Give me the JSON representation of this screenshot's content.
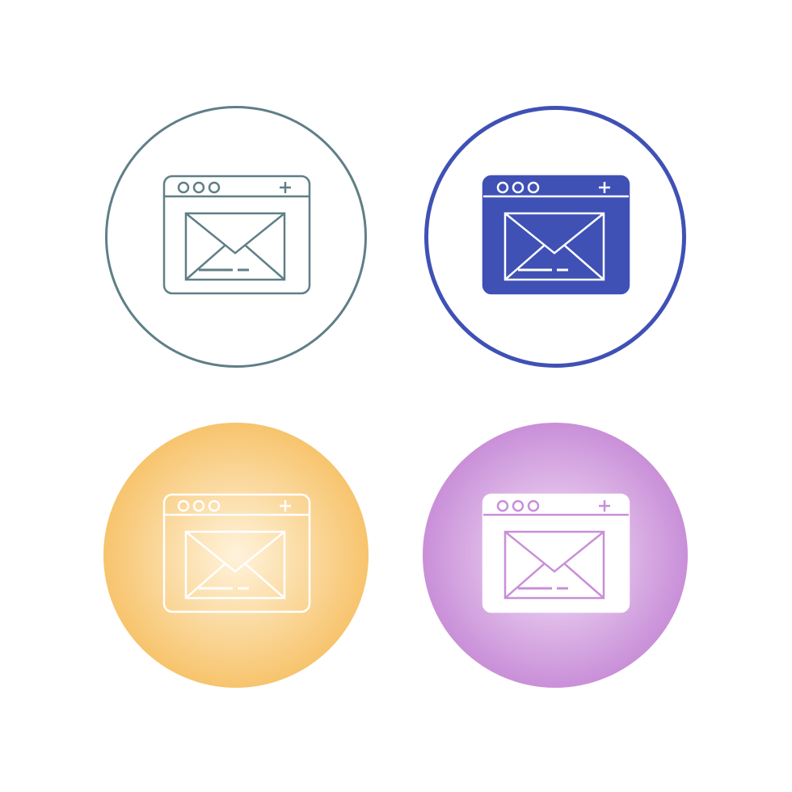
{
  "icons": [
    {
      "name": "browser-mail-icon-line",
      "style": "line",
      "circle_stroke": "#5f7f86",
      "window_stroke": "#5f7f86",
      "window_fill": "none",
      "glyph_stroke": "#5f7f86"
    },
    {
      "name": "browser-mail-icon-glyph",
      "style": "glyph",
      "circle_stroke": "#3f51b5",
      "window_stroke": "#3f51b5",
      "window_fill": "#3f51b5",
      "glyph_stroke": "#ffffff"
    },
    {
      "name": "browser-mail-icon-gradient-orange",
      "style": "gradient-line",
      "gradient_inner": "#fff3dc",
      "gradient_outer": "#f7c46d",
      "window_stroke": "#ffffff",
      "window_fill": "none",
      "glyph_stroke": "#ffffff"
    },
    {
      "name": "browser-mail-icon-gradient-purple",
      "style": "gradient-glyph",
      "gradient_inner": "#f4e3f8",
      "gradient_outer": "#c98fd8",
      "window_stroke": "#ffffff",
      "window_fill": "#ffffff",
      "glyph_stroke": "#c98fd8"
    }
  ]
}
